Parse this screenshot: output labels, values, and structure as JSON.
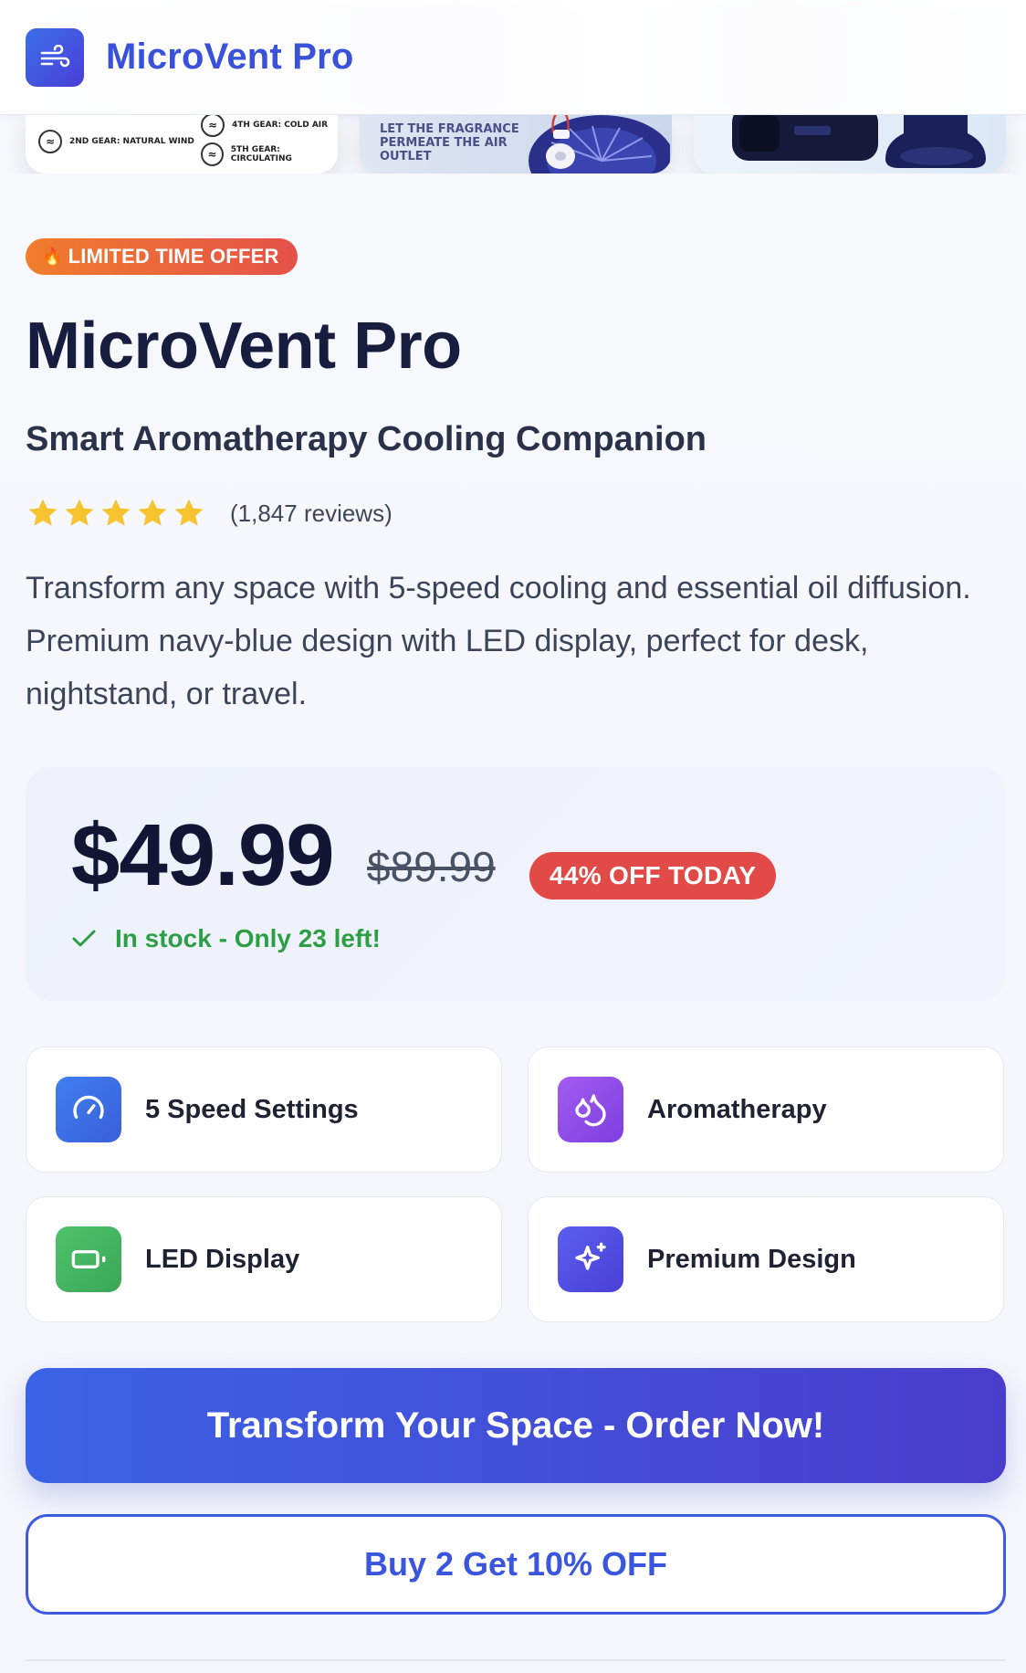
{
  "header": {
    "brand": "MicroVent Pro",
    "logo_icon": "wind-icon"
  },
  "gallery": {
    "thumb1": {
      "gear_2": "2ND GEAR: NATURAL WIND",
      "gear_4": "4TH GEAR: COLD AIR",
      "gear_5": "5TH GEAR: CIRCULATING"
    },
    "thumb2": {
      "caption_line1": "LET THE FRAGRANCE",
      "caption_line2": "PERMEATE THE AIR",
      "caption_line3": "OUTLET"
    }
  },
  "product": {
    "badge": "LIMITED TIME OFFER",
    "badge_icon": "flame-icon",
    "title": "MicroVent Pro",
    "subtitle": "Smart Aromatherapy Cooling Companion",
    "rating": 5,
    "reviews": "(1,847 reviews)",
    "description": "Transform any space with 5-speed cooling and essential oil diffusion. Premium navy-blue design with LED display, perfect for desk, nightstand, or travel."
  },
  "pricing": {
    "price": "$49.99",
    "old_price": "$89.99",
    "discount": "44% OFF TODAY",
    "stock": "In stock - Only 23 left!"
  },
  "features": [
    {
      "label": "5 Speed Settings",
      "icon": "gauge-icon"
    },
    {
      "label": "Aromatherapy",
      "icon": "droplets-icon"
    },
    {
      "label": "LED Display",
      "icon": "battery-icon"
    },
    {
      "label": "Premium Design",
      "icon": "sparkles-icon"
    }
  ],
  "actions": {
    "primary": "Transform Your Space - Order Now!",
    "secondary": "Buy 2 Get 10% OFF"
  },
  "colors": {
    "accent": "#3a52d9",
    "badge_orange": "#f07d2c",
    "discount_red": "#e24a48",
    "stock_green": "#2e9e46",
    "star_yellow": "#f6c431"
  }
}
